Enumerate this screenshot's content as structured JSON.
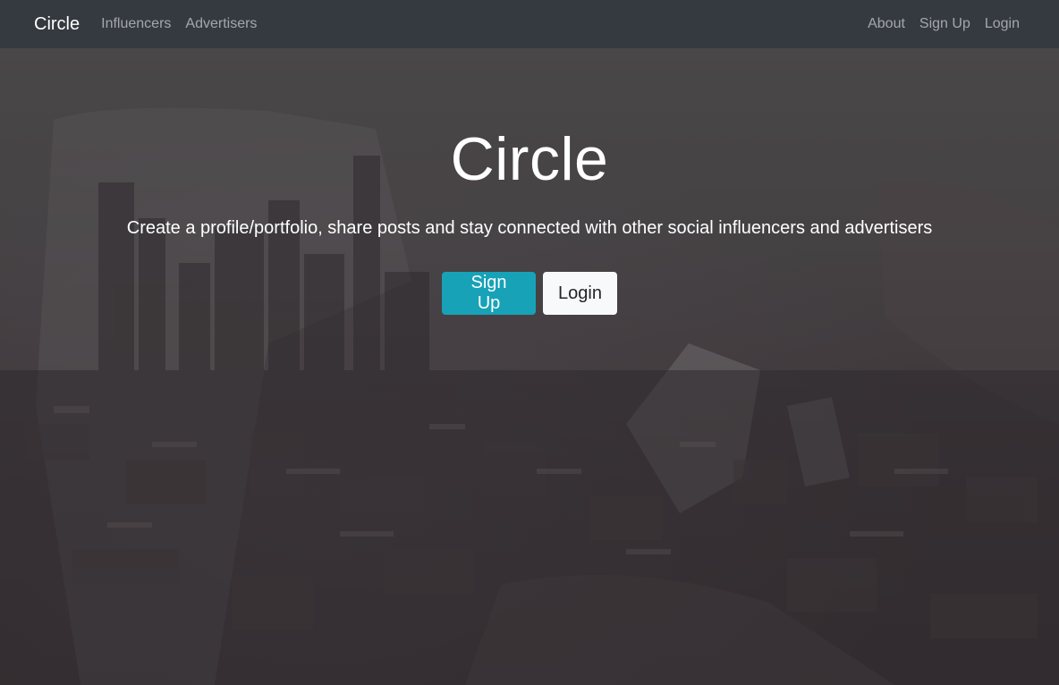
{
  "navbar": {
    "brand": "Circle",
    "left_links": [
      "Influencers",
      "Advertisers"
    ],
    "right_links": [
      "About",
      "Sign Up",
      "Login"
    ]
  },
  "hero": {
    "title": "Circle",
    "subtitle": "Create a profile/portfolio, share posts and stay connected with other social influencers and advertisers",
    "signup_label": "Sign Up",
    "login_label": "Login"
  },
  "colors": {
    "navbar_bg": "#343a40",
    "signup_bg": "#17a2b8",
    "login_bg": "#f8f9fa"
  }
}
